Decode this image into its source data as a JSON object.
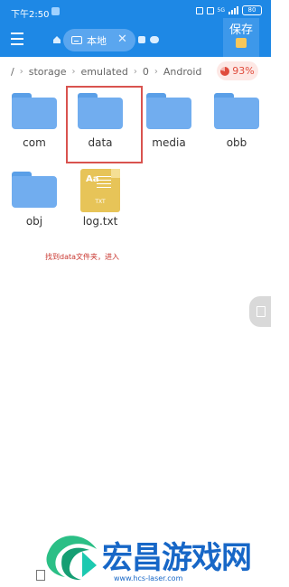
{
  "status_bar": {
    "time": "下午2:50",
    "network": "5G",
    "battery": "80"
  },
  "toolbar": {
    "location_chip": "本地",
    "close_symbol": "✕",
    "save_label": "保存"
  },
  "breadcrumb": {
    "root": "/",
    "items": [
      "storage",
      "emulated",
      "0",
      "Android"
    ],
    "storage_usage": "93%"
  },
  "files": [
    {
      "name": "com",
      "type": "folder"
    },
    {
      "name": "data",
      "type": "folder"
    },
    {
      "name": "media",
      "type": "folder"
    },
    {
      "name": "obb",
      "type": "folder"
    },
    {
      "name": "obj",
      "type": "folder"
    },
    {
      "name": "log.txt",
      "type": "text-file"
    }
  ],
  "file_icon_text": {
    "aa": "Aa",
    "extension": "TXT"
  },
  "annotation": "找到data文件夹，进入",
  "watermark": {
    "title": "宏昌游戏网",
    "url": "www.hcs-laser.com"
  },
  "colors": {
    "primary": "#1e88e5",
    "folder": "#71adef",
    "highlight": "#d9534f",
    "storage_warning": "#e04c3d",
    "watermark": "#1767c7"
  }
}
